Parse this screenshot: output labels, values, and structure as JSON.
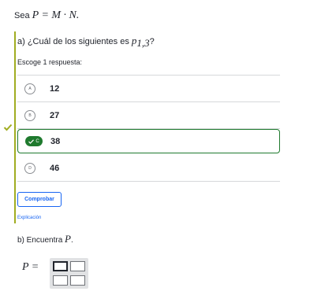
{
  "intro": {
    "prefix": "Sea",
    "formula": "P = M · N."
  },
  "part_a": {
    "label": "a) ¿Cuál de los siguientes es",
    "symbol": "p",
    "subscript": "1,3",
    "suffix": "?",
    "instruction": "Escoge 1 respuesta:",
    "choices": [
      {
        "letter": "A",
        "value": "12",
        "selected": false
      },
      {
        "letter": "B",
        "value": "27",
        "selected": false
      },
      {
        "letter": "C",
        "value": "38",
        "selected": true
      },
      {
        "letter": "D",
        "value": "46",
        "selected": false
      }
    ],
    "check_button": "Comprobar",
    "explain_link": "Explicación"
  },
  "part_b": {
    "label": "b) Encuentra",
    "symbol": "P",
    "suffix": ".",
    "answer_label": "P ="
  },
  "colors": {
    "accent": "#1865f2",
    "correct": "#1f7a2e",
    "bar": "#a1ad21"
  },
  "icons": {
    "correct_mark": "check-icon"
  }
}
